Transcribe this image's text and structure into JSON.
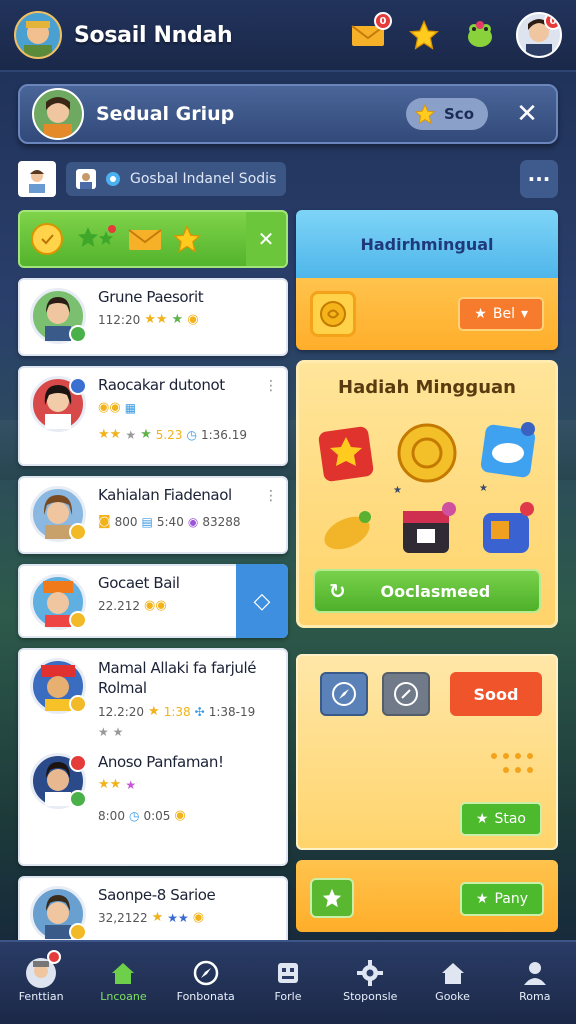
{
  "app": {
    "title": "Sosail Nndah"
  },
  "group": {
    "title": "Sedual Griup",
    "score_label": "Sco"
  },
  "filter": {
    "chip_label": "Gosbal Indanel Sodis"
  },
  "feed": [
    {
      "name": "Grune Paesorit",
      "meta": "112:20"
    },
    {
      "name": "Raocakar dutonot",
      "meta": "1:36.19",
      "meta2": "5.23"
    },
    {
      "name": "Kahialan Fiadenaol",
      "meta": "800",
      "meta2": "5:40",
      "meta3": "83288"
    },
    {
      "name": "Gocaet Bail",
      "meta": "22.212"
    },
    {
      "name": "Mamal Allaki fa farjulé Rolmal",
      "meta": "12.2:20",
      "meta2": "1:38",
      "meta3": "1:38-19"
    },
    {
      "name": "Anoso Panfaman!",
      "meta": "8:00",
      "meta2": "0:05"
    },
    {
      "name": "Saonpe-8 Sarioe",
      "meta": "32,2122"
    }
  ],
  "weekly": {
    "title": "Hadirhmingual",
    "button_label": "Bel"
  },
  "rewards": {
    "title": "Hadiah Mingguan",
    "claim_label": "Ooclasmeed"
  },
  "actions": {
    "red_label": "Sood",
    "green_label": "Stao"
  },
  "bottom_panel": {
    "button_label": "Pany"
  },
  "nav": [
    {
      "label": "Fenttian"
    },
    {
      "label": "Lncoane"
    },
    {
      "label": "Fonbonata"
    },
    {
      "label": "Forle"
    },
    {
      "label": "Stoponsle"
    },
    {
      "label": "Gooke"
    },
    {
      "label": "Roma"
    }
  ],
  "colors": {
    "accent_green": "#4eb02a",
    "accent_orange": "#f77b2c",
    "accent_red": "#f0542b",
    "nav_bg": "#1b2847"
  },
  "icons": [
    "mail-icon",
    "star-icon",
    "frog-icon",
    "coin-icon",
    "gear-icon",
    "home-icon",
    "person-icon"
  ]
}
